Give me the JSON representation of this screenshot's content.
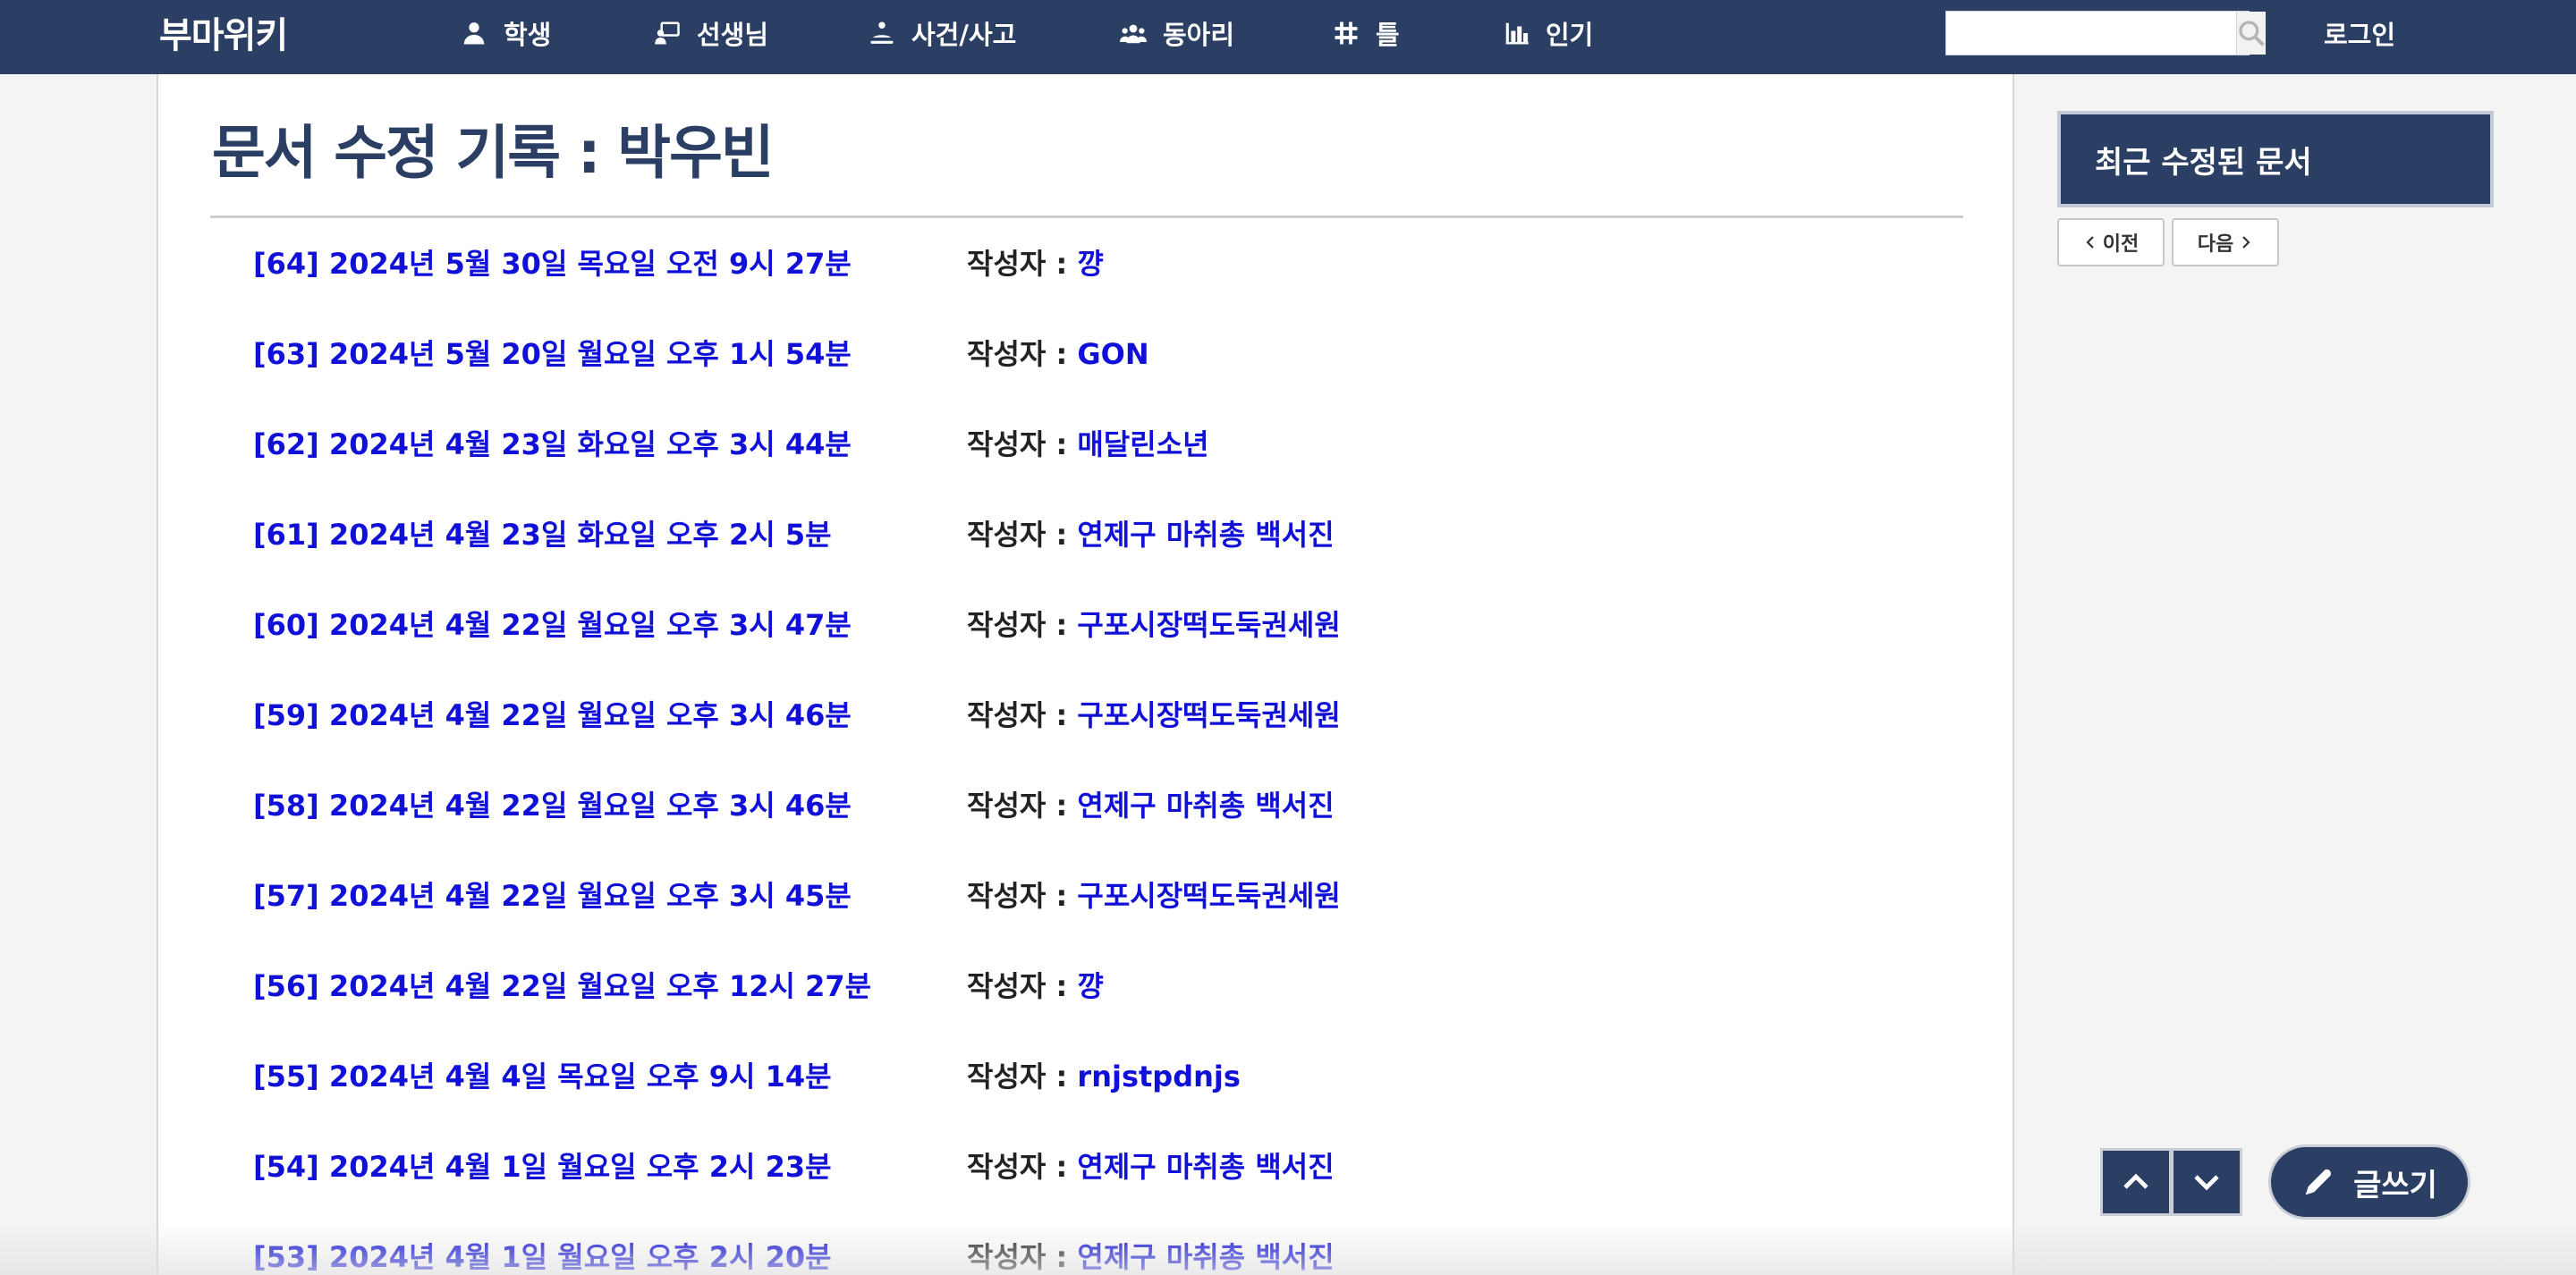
{
  "nav": {
    "logo": "부마위키",
    "items": [
      {
        "label": "학생",
        "icon": "person-icon"
      },
      {
        "label": "선생님",
        "icon": "teacher-icon"
      },
      {
        "label": "사건/사고",
        "icon": "incident-icon"
      },
      {
        "label": "동아리",
        "icon": "group-icon"
      },
      {
        "label": "틀",
        "icon": "hash-icon"
      },
      {
        "label": "인기",
        "icon": "bar-chart-icon"
      }
    ],
    "search_placeholder": "",
    "login": "로그인"
  },
  "page": {
    "title": "문서 수정 기록 : 박우빈",
    "author_label": "작성자 : ",
    "history": [
      {
        "rev": "[64] 2024년 5월 30일 목요일 오전 9시 27분",
        "author": "꺙"
      },
      {
        "rev": "[63] 2024년 5월 20일 월요일 오후 1시 54분",
        "author": "GON"
      },
      {
        "rev": "[62] 2024년 4월 23일 화요일 오후 3시 44분",
        "author": "매달린소년"
      },
      {
        "rev": "[61] 2024년 4월 23일 화요일 오후 2시 5분",
        "author": "연제구 마취총 백서진"
      },
      {
        "rev": "[60] 2024년 4월 22일 월요일 오후 3시 47분",
        "author": "구포시장떡도둑권세원"
      },
      {
        "rev": "[59] 2024년 4월 22일 월요일 오후 3시 46분",
        "author": "구포시장떡도둑권세원"
      },
      {
        "rev": "[58] 2024년 4월 22일 월요일 오후 3시 46분",
        "author": "연제구 마취총 백서진"
      },
      {
        "rev": "[57] 2024년 4월 22일 월요일 오후 3시 45분",
        "author": "구포시장떡도둑권세원"
      },
      {
        "rev": "[56] 2024년 4월 22일 월요일 오후 12시 27분",
        "author": "꺙"
      },
      {
        "rev": "[55] 2024년 4월 4일 목요일 오후 9시 14분",
        "author": "rnjstpdnjs"
      },
      {
        "rev": "[54] 2024년 4월 1일 월요일 오후 2시 23분",
        "author": "연제구 마취총 백서진"
      },
      {
        "rev": "[53] 2024년 4월 1일 월요일 오후 2시 20분",
        "author": "연제구 마취총 백서진"
      }
    ]
  },
  "sidebar": {
    "recent_title": "최근 수정된 문서",
    "prev": "이전",
    "next": "다음",
    "write": "글쓰기"
  },
  "colors": {
    "navy": "#2b3e63",
    "link": "#1010d8"
  }
}
